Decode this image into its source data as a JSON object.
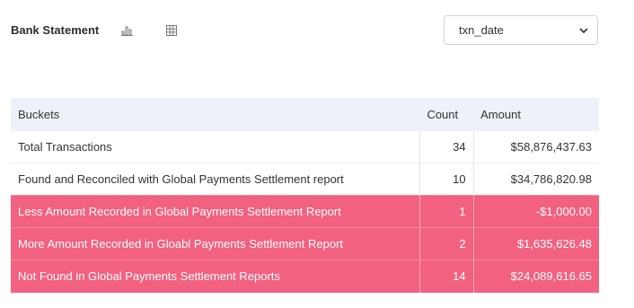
{
  "header": {
    "title": "Bank Statement"
  },
  "controls": {
    "chart_icon": "bar-chart-icon",
    "table_icon": "grid-table-icon",
    "select_value": "txn_date"
  },
  "table": {
    "headers": {
      "buckets": "Buckets",
      "count": "Count",
      "amount": "Amount"
    },
    "rows": [
      {
        "bucket": "Total Transactions",
        "count": "34",
        "amount": "$58,876,437.63",
        "highlight": false
      },
      {
        "bucket": "Found and Reconciled with Global Payments Settlement report",
        "count": "10",
        "amount": "$34,786,820.98",
        "highlight": false
      },
      {
        "bucket": "Less Amount Recorded in Global Payments Settlement Report",
        "count": "1",
        "amount": "-$1,000.00",
        "highlight": true
      },
      {
        "bucket": "More Amount Recorded in Gloabl Payments Settlement Report",
        "count": "2",
        "amount": "$1,635,626.48",
        "highlight": true
      },
      {
        "bucket": "Not Found in Global Payments Settlement Reports",
        "count": "14",
        "amount": "$24,089,616.65",
        "highlight": true
      }
    ]
  },
  "colors": {
    "highlight_row": "#f2617f",
    "header_bg": "#eef1fa"
  }
}
